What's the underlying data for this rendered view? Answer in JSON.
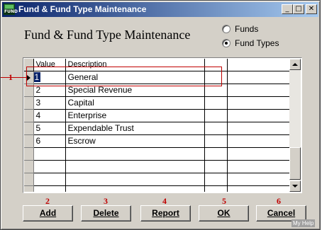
{
  "window": {
    "app_icon_text": "FUND",
    "title": "Fund & Fund Type Maintenance",
    "controls": {
      "minimize": "_",
      "maximize": "□",
      "close": "✕"
    }
  },
  "heading": "Fund & Fund Type Maintenance",
  "view_toggle": {
    "options": [
      {
        "label": "Funds",
        "selected": false
      },
      {
        "label": "Fund Types",
        "selected": true
      }
    ]
  },
  "grid": {
    "columns": [
      "Value",
      "Description"
    ],
    "rows": [
      {
        "value": "1",
        "description": "General"
      },
      {
        "value": "2",
        "description": "Special Revenue"
      },
      {
        "value": "3",
        "description": "Capital"
      },
      {
        "value": "4",
        "description": "Enterprise"
      },
      {
        "value": "5",
        "description": "Expendable Trust"
      },
      {
        "value": "6",
        "description": "Escrow"
      }
    ]
  },
  "callouts": [
    "1",
    "2",
    "3",
    "4",
    "5",
    "6"
  ],
  "buttons": {
    "add": "Add",
    "delete": "Delete",
    "report": "Report",
    "ok": "OK",
    "cancel": "Cancel"
  },
  "help_badge": "My Help",
  "colors": {
    "callout": "#c00000",
    "titlebar": "#0a246a",
    "selection": "#0a246a"
  }
}
